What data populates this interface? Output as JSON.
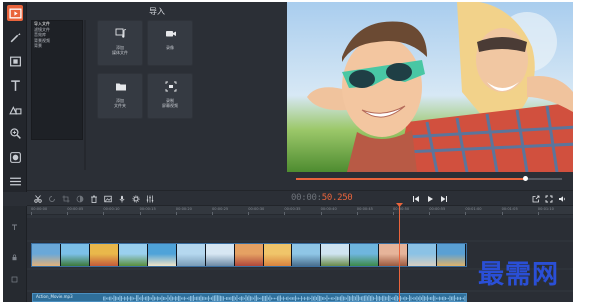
{
  "import_panel": {
    "title": "导入",
    "categories": [
      {
        "label": "导入文件",
        "selected": true
      },
      {
        "label": "滤镜文件",
        "selected": false
      },
      {
        "label": "音效库",
        "selected": false
      },
      {
        "label": "背景视频",
        "selected": false
      },
      {
        "label": "背景",
        "selected": false
      }
    ],
    "tiles": [
      {
        "label": "添加\n媒体文件",
        "icon": "music-film-icon"
      },
      {
        "label": "录像",
        "icon": "video-camera-icon"
      },
      {
        "label": "添加\n文件夹",
        "icon": "folder-icon"
      },
      {
        "label": "录制\n屏幕视频",
        "icon": "screen-record-icon"
      }
    ]
  },
  "playback": {
    "timecode_dim": "00:00:",
    "timecode_accent": "50.250",
    "progress": 0.86
  },
  "timeline": {
    "ruler_ticks": [
      "00:00:00",
      "00:00:05",
      "00:00:10",
      "00:00:15",
      "00:00:20",
      "00:00:25",
      "00:00:30",
      "00:00:35",
      "00:00:40",
      "00:00:45",
      "00:00:50",
      "00:00:55",
      "00:01:00",
      "00:01:05",
      "00:01:10",
      "00:01:15"
    ],
    "audio_clip_name": "Action_Movie.mp3",
    "thumbnail_count": 15
  },
  "watermark": "最需网",
  "colors": {
    "accent": "#e9643c",
    "panel": "#2b2f36",
    "rail": "#23262c",
    "audio": "#2f6f9a",
    "watermark": "#2a4fd6"
  }
}
